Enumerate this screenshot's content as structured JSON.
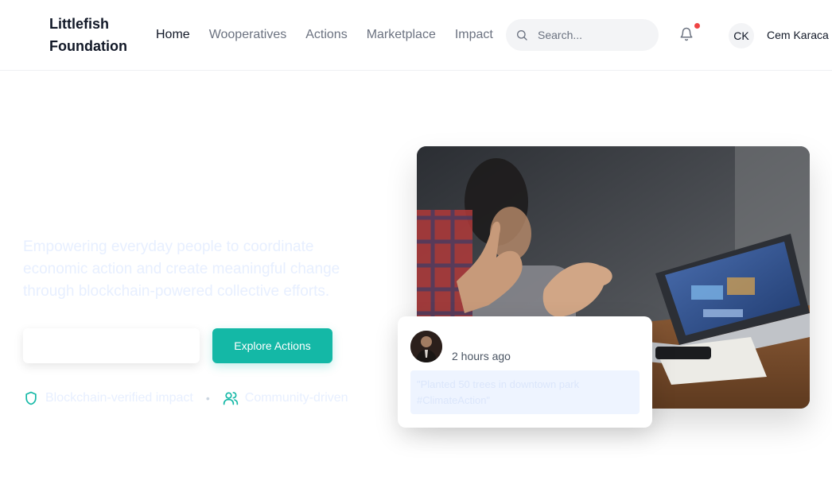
{
  "brand": {
    "name": "Littlefish Foundation"
  },
  "nav": {
    "items": [
      {
        "label": "Home",
        "active": true
      },
      {
        "label": "Wooperatives",
        "active": false
      },
      {
        "label": "Actions",
        "active": false
      },
      {
        "label": "Marketplace",
        "active": false
      },
      {
        "label": "Impact",
        "active": false
      }
    ]
  },
  "search": {
    "placeholder": "Search...",
    "value": ""
  },
  "notifications": {
    "icon": "bell-icon",
    "has_unread": true
  },
  "user": {
    "initials": "CK",
    "name": "Cem Karaca"
  },
  "hero": {
    "tagline": "Empowering everyday people to coordinate economic action and create meaningful change through blockchain-powered collective efforts.",
    "primary_button_label": "",
    "explore_button_label": "Explore Actions",
    "features": [
      {
        "icon": "shield-icon",
        "label": "Blockchain-verified impact"
      },
      {
        "icon": "users-icon",
        "label": "Community-driven"
      }
    ],
    "separator": "•"
  },
  "activity_card": {
    "time": "2 hours ago",
    "text": "\"Planted 50 trees in downtown park #ClimateAction\""
  },
  "colors": {
    "accent": "#14b8a6",
    "notification_dot": "#ef4444",
    "faded_text": "#e7efff"
  }
}
